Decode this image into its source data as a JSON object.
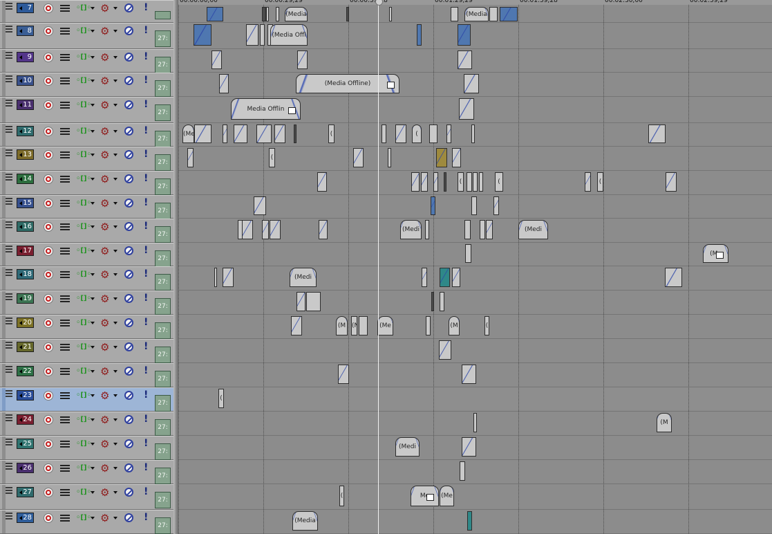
{
  "ruler": {
    "labels": [
      "00:00:00;00",
      "00:00:29;29",
      "00:00:59;28",
      "00:01:29;29",
      "00:01:59;28",
      "00:02:30;00",
      "00:02:59;29"
    ]
  },
  "cursor_time": "00:01:10;00",
  "colors": {
    "accent_selected": "#9db5d6",
    "record": "#c41c1c",
    "mute": "#2e3f9e"
  },
  "tracks": [
    {
      "number": "7",
      "level": "",
      "color": "#2d5a9a",
      "selected": false
    },
    {
      "number": "8",
      "level": "27:",
      "color": "#3a5e95",
      "selected": false
    },
    {
      "number": "9",
      "level": "27:",
      "color": "#53358a",
      "selected": false
    },
    {
      "number": "10",
      "level": "27:",
      "color": "#3a528c",
      "selected": false
    },
    {
      "number": "11",
      "level": "27:",
      "color": "#4a2f6f",
      "selected": false
    },
    {
      "number": "12",
      "level": "27:",
      "color": "#2f6b6d",
      "selected": false
    },
    {
      "number": "13",
      "level": "27:",
      "color": "#7d6c2a",
      "selected": false
    },
    {
      "number": "14",
      "level": "27:",
      "color": "#2c6e3e",
      "selected": false
    },
    {
      "number": "15",
      "level": "27:",
      "color": "#36508e",
      "selected": false
    },
    {
      "number": "16",
      "level": "27:",
      "color": "#2f6b66",
      "selected": false
    },
    {
      "number": "17",
      "level": "27:",
      "color": "#7a1f30",
      "selected": false
    },
    {
      "number": "18",
      "level": "27:",
      "color": "#2f6a78",
      "selected": false
    },
    {
      "number": "19",
      "level": "27:",
      "color": "#3c7553",
      "selected": false
    },
    {
      "number": "20",
      "level": "27:",
      "color": "#7d7226",
      "selected": false
    },
    {
      "number": "21",
      "level": "27:",
      "color": "#66682b",
      "selected": false
    },
    {
      "number": "22",
      "level": "27:",
      "color": "#2d7046",
      "selected": false
    },
    {
      "number": "23",
      "level": "27:",
      "color": "#2a4d9a",
      "selected": true
    },
    {
      "number": "24",
      "level": "27:",
      "color": "#7a1f30",
      "selected": false
    },
    {
      "number": "25",
      "level": "27:",
      "color": "#2f7470",
      "selected": false
    },
    {
      "number": "26",
      "level": "27:",
      "color": "#4a2f6f",
      "selected": false
    },
    {
      "number": "27",
      "level": "27:",
      "color": "#2f6b6d",
      "selected": false
    },
    {
      "number": "28",
      "level": "27:",
      "color": "#2f5e9c",
      "selected": false
    }
  ],
  "offline_label": "(Media Offline)",
  "events": [
    [
      {
        "t": 9.4,
        "d": 5.9,
        "k": "blue",
        "s": "fade"
      },
      {
        "t": 29.0,
        "d": 1.5,
        "k": "dark"
      },
      {
        "t": 30.6,
        "d": 1.0
      },
      {
        "t": 34.0,
        "d": 1.2
      },
      {
        "t": 37.0,
        "d": 8.0,
        "s": "wide",
        "x": "(Media"
      },
      {
        "t": 58.7,
        "d": 0.6,
        "k": "dark"
      },
      {
        "t": 74.0,
        "d": 0.9
      },
      {
        "t": 95.6,
        "d": 2.6
      },
      {
        "t": 100.4,
        "d": 8.6,
        "s": "wide",
        "x": "(Media"
      },
      {
        "t": 109.2,
        "d": 3.0
      },
      {
        "t": 113.0,
        "d": 6.3,
        "k": "blue",
        "s": "fade"
      }
    ],
    [
      {
        "t": 4.9,
        "d": 6.4,
        "k": "blue",
        "s": "fade"
      },
      {
        "t": 23.4,
        "d": 4.3,
        "s": "fade"
      },
      {
        "t": 28.2,
        "d": 1.8
      },
      {
        "t": 31.0,
        "d": 2.0
      },
      {
        "t": 31.9,
        "d": 13.1,
        "s": "wide",
        "x": "(Media Offl"
      },
      {
        "t": 83.7,
        "d": 1.8,
        "k": "blue"
      },
      {
        "t": 98.0,
        "d": 4.6,
        "k": "blue",
        "s": "fade"
      }
    ],
    [
      {
        "t": 11.1,
        "d": 3.6,
        "s": "fade"
      },
      {
        "t": 41.4,
        "d": 3.6,
        "s": "fade"
      },
      {
        "t": 98.0,
        "d": 5.0,
        "s": "fade"
      }
    ],
    [
      {
        "t": 14.0,
        "d": 3.3,
        "s": "fade"
      },
      {
        "t": 41.0,
        "d": 36.6,
        "s": "wide",
        "x": "(Media Offline)",
        "h": 1
      },
      {
        "t": 100.2,
        "d": 5.4,
        "s": "fade"
      }
    ],
    [
      {
        "t": 18.0,
        "d": 24.7,
        "s": "wide",
        "x": "Media Offlin",
        "h": 1
      },
      {
        "t": 98.4,
        "d": 5.4,
        "s": "fade"
      }
    ],
    [
      {
        "t": 1.0,
        "d": 4.2,
        "s": "wide",
        "x": "(Me"
      },
      {
        "t": 5.2,
        "d": 6.0,
        "s": "fade"
      },
      {
        "t": 15.2,
        "d": 1.8,
        "s": "fade"
      },
      {
        "t": 18.9,
        "d": 4.8,
        "s": "fade"
      },
      {
        "t": 27.0,
        "d": 5.3,
        "s": "fade"
      },
      {
        "t": 33.3,
        "d": 4.0,
        "s": "fade"
      },
      {
        "t": 40.3,
        "d": 0.8,
        "k": "dark"
      },
      {
        "t": 52.5,
        "d": 2.2,
        "x": "("
      },
      {
        "t": 71.2,
        "d": 1.8
      },
      {
        "t": 76.2,
        "d": 4.0,
        "s": "fade"
      },
      {
        "t": 82.0,
        "d": 3.5,
        "s": "wide",
        "x": "("
      },
      {
        "t": 88.0,
        "d": 3.0
      },
      {
        "t": 94.2,
        "d": 1.8,
        "s": "fade"
      },
      {
        "t": 102.8,
        "d": 1.3
      },
      {
        "t": 165.3,
        "d": 6.0,
        "s": "fade"
      }
    ],
    [
      {
        "t": 2.7,
        "d": 2.3,
        "s": "fade"
      },
      {
        "t": 31.5,
        "d": 2.3,
        "x": "("
      },
      {
        "t": 61.3,
        "d": 3.6,
        "s": "fade"
      },
      {
        "t": 73.3,
        "d": 1.3
      },
      {
        "t": 90.5,
        "d": 4.0,
        "k": "olive",
        "s": "fade"
      },
      {
        "t": 96.0,
        "d": 3.2,
        "s": "fade"
      }
    ],
    [
      {
        "t": 48.6,
        "d": 3.3,
        "s": "fade"
      },
      {
        "t": 81.8,
        "d": 3.0,
        "s": "fade"
      },
      {
        "t": 85.1,
        "d": 2.4,
        "s": "fade"
      },
      {
        "t": 89.4,
        "d": 1.6,
        "s": "fade"
      },
      {
        "t": 93.1,
        "d": 0.6,
        "k": "dark"
      },
      {
        "t": 98.0,
        "d": 2.3,
        "x": "("
      },
      {
        "t": 101.1,
        "d": 2.0
      },
      {
        "t": 103.3,
        "d": 1.7
      },
      {
        "t": 105.7,
        "d": 1.5
      },
      {
        "t": 111.1,
        "d": 3.0,
        "x": "("
      },
      {
        "t": 143.0,
        "d": 2.1,
        "s": "fade"
      },
      {
        "t": 147.2,
        "d": 2.1,
        "x": "("
      },
      {
        "t": 171.5,
        "d": 3.8,
        "s": "fade"
      }
    ],
    [
      {
        "t": 26.0,
        "d": 4.5,
        "s": "fade"
      },
      {
        "t": 88.4,
        "d": 1.6,
        "k": "blue",
        "s": "fade"
      },
      {
        "t": 102.8,
        "d": 2.0
      },
      {
        "t": 110.6,
        "d": 1.9,
        "s": "fade"
      }
    ],
    [
      {
        "t": 20.6,
        "d": 2.0
      },
      {
        "t": 22.0,
        "d": 3.8,
        "s": "fade"
      },
      {
        "t": 28.9,
        "d": 2.5,
        "s": "fade"
      },
      {
        "t": 31.7,
        "d": 3.8,
        "s": "fade"
      },
      {
        "t": 48.9,
        "d": 3.2,
        "s": "fade"
      },
      {
        "t": 77.7,
        "d": 7.5,
        "s": "wide",
        "x": "(Medi"
      },
      {
        "t": 86.5,
        "d": 1.5
      },
      {
        "t": 100.4,
        "d": 2.2
      },
      {
        "t": 105.8,
        "d": 1.9
      },
      {
        "t": 108.0,
        "d": 2.5,
        "s": "fade"
      },
      {
        "t": 119.5,
        "d": 10.6,
        "s": "wide",
        "x": "(Medi"
      }
    ],
    [
      {
        "t": 100.8,
        "d": 2.3
      },
      {
        "t": 184.6,
        "d": 9.0,
        "s": "wide",
        "x": "(Me",
        "h": 1
      }
    ],
    [
      {
        "t": 12.2,
        "d": 1.0
      },
      {
        "t": 15.0,
        "d": 3.8,
        "s": "fade"
      },
      {
        "t": 38.8,
        "d": 9.6,
        "s": "wide",
        "x": "(Medi"
      },
      {
        "t": 85.4,
        "d": 2.0,
        "s": "fade"
      },
      {
        "t": 91.6,
        "d": 3.6,
        "k": "cyan",
        "s": "fade"
      },
      {
        "t": 96.1,
        "d": 3.0,
        "s": "fade"
      },
      {
        "t": 171.1,
        "d": 6.0,
        "s": "fade"
      }
    ],
    [
      {
        "t": 41.2,
        "d": 3.2,
        "s": "fade"
      },
      {
        "t": 44.6,
        "d": 5.0
      },
      {
        "t": 88.8,
        "d": 0.8,
        "k": "dark"
      },
      {
        "t": 91.8,
        "d": 1.8
      }
    ],
    [
      {
        "t": 39.2,
        "d": 4.0,
        "s": "fade"
      },
      {
        "t": 55.0,
        "d": 4.2,
        "s": "wide",
        "x": "(M"
      },
      {
        "t": 60.5,
        "d": 2.3,
        "x": "(N"
      },
      {
        "t": 63.2,
        "d": 3.2
      },
      {
        "t": 69.8,
        "d": 5.5,
        "s": "wide",
        "x": "(Me"
      },
      {
        "t": 86.7,
        "d": 1.6
      },
      {
        "t": 94.8,
        "d": 3.8,
        "s": "wide",
        "x": "(M"
      },
      {
        "t": 107.5,
        "d": 1.8,
        "x": "("
      }
    ],
    [
      {
        "t": 91.4,
        "d": 4.5,
        "s": "fade"
      }
    ],
    [
      {
        "t": 55.8,
        "d": 3.8,
        "s": "fade"
      },
      {
        "t": 99.6,
        "d": 5.0,
        "s": "fade"
      }
    ],
    [
      {
        "t": 13.7,
        "d": 2.0,
        "x": "("
      }
    ],
    [
      {
        "t": 103.6,
        "d": 1.2
      },
      {
        "t": 168.2,
        "d": 5.3,
        "s": "wide",
        "x": "(M"
      }
    ],
    [
      {
        "t": 76.0,
        "d": 8.6,
        "s": "wide",
        "x": "(Medi"
      },
      {
        "t": 99.4,
        "d": 5.2,
        "s": "fade"
      }
    ],
    [
      {
        "t": 98.8,
        "d": 2.0
      }
    ],
    [
      {
        "t": 56.4,
        "d": 1.8,
        "x": "("
      },
      {
        "t": 81.5,
        "d": 10.0,
        "s": "wide",
        "x": "Me",
        "h": 1
      },
      {
        "t": 91.6,
        "d": 5.0,
        "s": "wide",
        "x": "(Me"
      }
    ],
    [
      {
        "t": 39.8,
        "d": 9.0,
        "s": "wide",
        "x": "(Media"
      },
      {
        "t": 101.4,
        "d": 1.8,
        "k": "cyan"
      }
    ]
  ]
}
